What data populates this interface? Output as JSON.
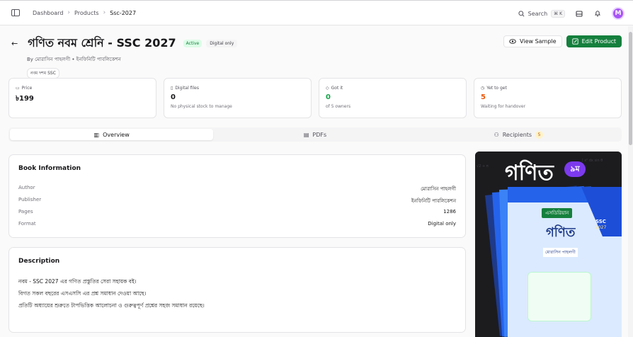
{
  "topbar": {
    "crumbs": [
      "Dashboard",
      "Products",
      "Ssc-2027"
    ],
    "search_label": "Search",
    "search_shortcut": "⌘ K",
    "avatar_initial": "M"
  },
  "header": {
    "title": "গণিত নবম শ্রেনি - SSC 2027",
    "status": "Active",
    "format_badge": "Digital only",
    "byline": "By মোরাসিন পাহলগী • ইনফিনিটি পাবলিকেশন",
    "tag": "নবম দশম SSC",
    "view_sample": "View Sample",
    "edit_product": "Edit Product"
  },
  "stats": [
    {
      "label": "Price",
      "value": "৳199",
      "sub": ""
    },
    {
      "label": "Digital files",
      "value": "0",
      "sub": "No physical stock to manage"
    },
    {
      "label": "Got it",
      "value": "0",
      "sub": "of 5 owners"
    },
    {
      "label": "Yet to get",
      "value": "5",
      "sub": "Waiting for handover"
    }
  ],
  "tabs": [
    {
      "label": "Overview",
      "active": true
    },
    {
      "label": "PDFs",
      "active": false
    },
    {
      "label": "Recipients",
      "active": false,
      "count": "5"
    }
  ],
  "book_info": {
    "title": "Book Information",
    "rows": [
      {
        "key": "Author",
        "value": "মোরাসিন পাহলগী"
      },
      {
        "key": "Publisher",
        "value": "ইনফিনিটি পাবলিকেশন"
      },
      {
        "key": "Pages",
        "value": "1286"
      },
      {
        "key": "Format",
        "value": "Digital only"
      }
    ]
  },
  "description": {
    "title": "Description",
    "lines": [
      "নবম - SSC 2027 এর গণিত প্রস্তুতির সেরা সহায়ক বই।",
      "বিগত সকল বছরের এসএসসি এর প্রশ্ন সমাধান দেওয়া আছে।",
      "প্রতিটি অধ্যায়ের শুরুতে টাপভিত্তিক আলোচনা ও গুরুত্বপূর্ণ প্রশ্নের সহজ সমাধান রয়েছে।"
    ]
  },
  "cover": {
    "big_title": "গণিত",
    "grade_badge": "৯ম",
    "book_title": "গণিত",
    "series_label": "এসডিরিয়ান",
    "ssc": "SSC",
    "year": "2027",
    "author_banner": "মোরাসিন পাহলগী"
  }
}
